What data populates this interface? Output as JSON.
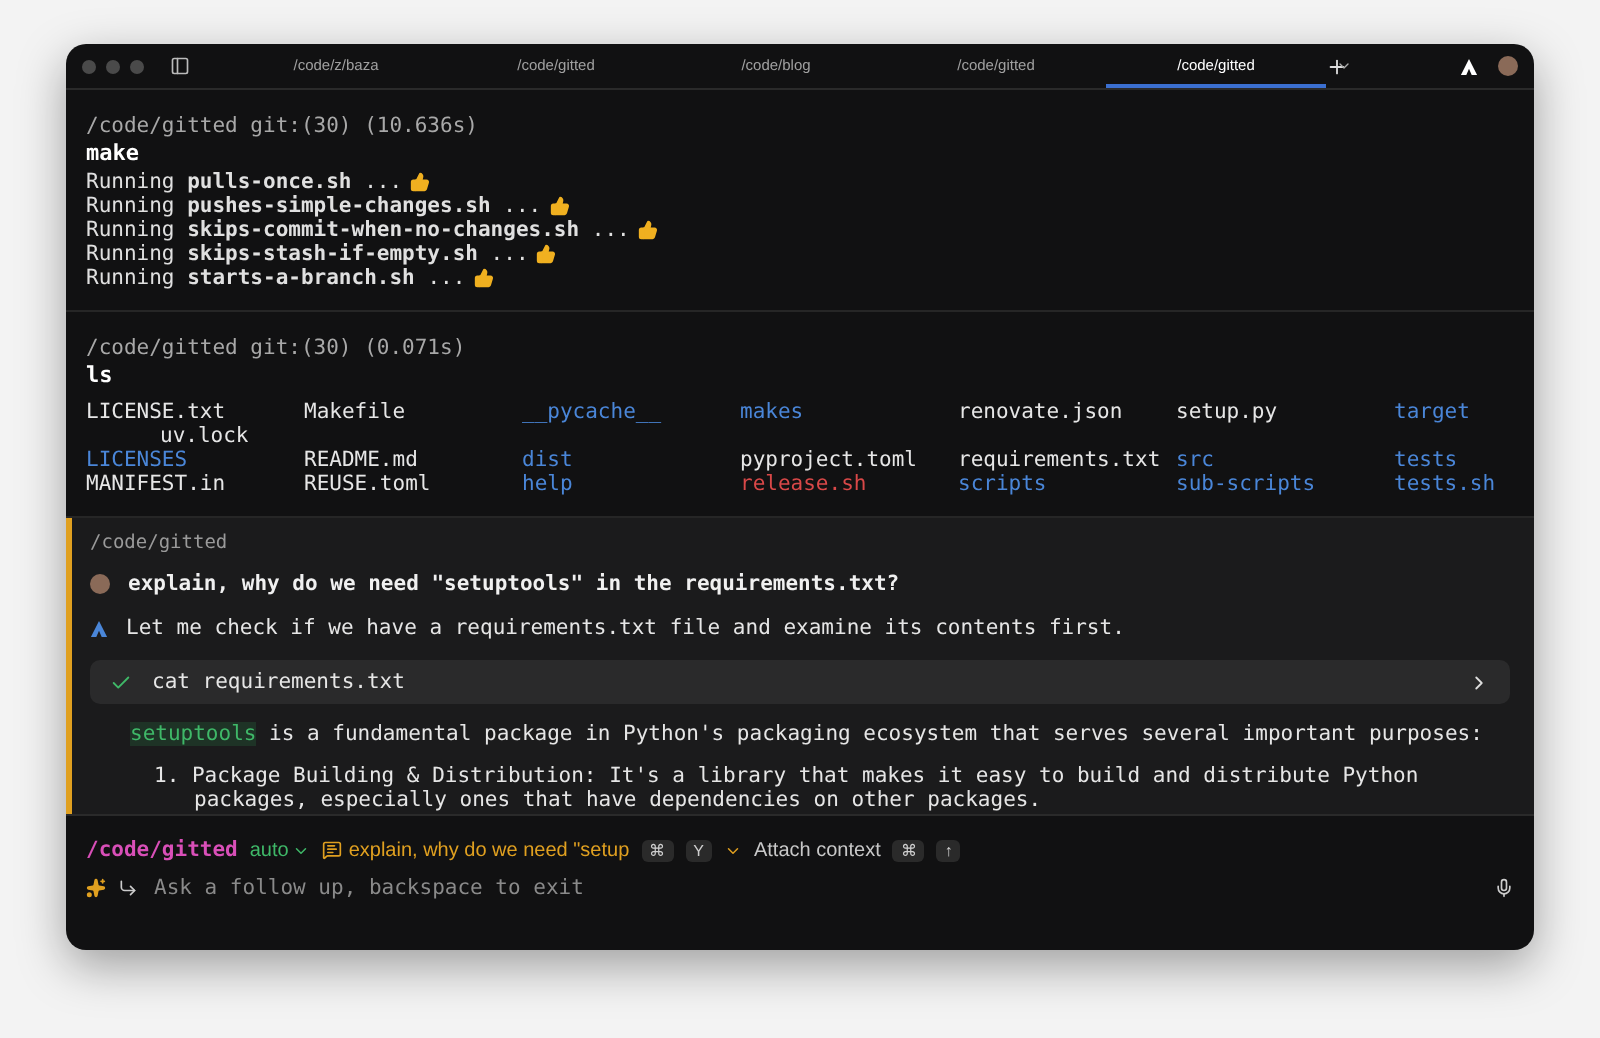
{
  "tabs": [
    {
      "label": "/code/z/baza",
      "selected": false
    },
    {
      "label": "/code/gitted",
      "selected": false
    },
    {
      "label": "/code/blog",
      "selected": false
    },
    {
      "label": "/code/gitted",
      "selected": false
    },
    {
      "label": "/code/gitted",
      "selected": true
    }
  ],
  "blocks": [
    {
      "prompt": "/code/gitted git:(30) (10.636s)",
      "command": "make",
      "output": [
        "Running **pulls-once.sh** ...",
        "Running **pushes-simple-changes.sh** ...",
        "Running **skips-commit-when-no-changes.sh** ...",
        "Running **skips-stash-if-empty.sh** ...",
        "Running **starts-a-branch.sh** ..."
      ]
    },
    {
      "prompt": "/code/gitted git:(30) (0.071s)",
      "command": "ls",
      "listing": [
        {
          "cells": [
            {
              "name": "LICENSE.txt",
              "kind": "file"
            },
            {
              "name": "Makefile",
              "kind": "file"
            },
            {
              "name": "__pycache__",
              "kind": "dir"
            },
            {
              "name": "makes",
              "kind": "dir"
            },
            {
              "name": "renovate.json",
              "kind": "file"
            },
            {
              "name": "setup.py",
              "kind": "file"
            },
            {
              "name": "target",
              "kind": "dir"
            }
          ],
          "overflow": "uv.lock"
        },
        {
          "cells": [
            {
              "name": "LICENSES",
              "kind": "dir"
            },
            {
              "name": "README.md",
              "kind": "file"
            },
            {
              "name": "dist",
              "kind": "dir"
            },
            {
              "name": "pyproject.toml",
              "kind": "file"
            },
            {
              "name": "requirements.txt",
              "kind": "file"
            },
            {
              "name": "src",
              "kind": "dir"
            },
            {
              "name": "tests",
              "kind": "dir"
            }
          ]
        },
        {
          "cells": [
            {
              "name": "MANIFEST.in",
              "kind": "file"
            },
            {
              "name": "REUSE.toml",
              "kind": "file"
            },
            {
              "name": "help",
              "kind": "dir"
            },
            {
              "name": "release.sh",
              "kind": "changed"
            },
            {
              "name": "scripts",
              "kind": "dir"
            },
            {
              "name": "sub-scripts",
              "kind": "dir"
            },
            {
              "name": "tests.sh",
              "kind": "dir"
            }
          ]
        }
      ]
    }
  ],
  "agent": {
    "path": "/code/gitted",
    "question": "explain, why do we need \"setuptools\" in the requirements.txt?",
    "reply": "Let me check if we have a requirements.txt file and examine its contents first.",
    "tool": {
      "command": "cat requirements.txt",
      "done": true
    },
    "answer": {
      "code": "setuptools",
      "text": " is a fundamental package in Python's packaging ecosystem that serves several important purposes:"
    },
    "points": [
      "1. Package Building & Distribution: It's a library that makes it easy to build and distribute Python packages, especially ones that have dependencies on other packages."
    ]
  },
  "input": {
    "path": "/code/gitted",
    "mode": "auto",
    "conversation": "explain, why do we need \"setup",
    "keys_1": [
      "⌘",
      "Y"
    ],
    "attach": "Attach context",
    "keys_2": [
      "⌘",
      "↑"
    ],
    "placeholder": "Ask a follow up, backspace to exit"
  }
}
